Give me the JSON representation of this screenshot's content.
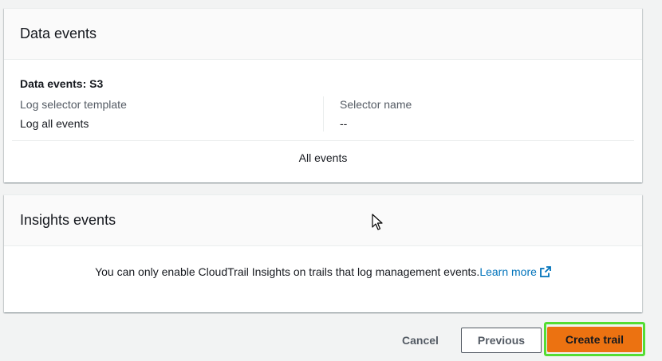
{
  "data_events_panel": {
    "header": "Data events",
    "section_title": "Data events: S3",
    "log_selector_label": "Log selector template",
    "log_selector_value": "Log all events",
    "selector_name_label": "Selector name",
    "selector_name_value": "--",
    "all_events_text": "All events"
  },
  "insights_panel": {
    "header": "Insights events",
    "message": "You can only enable CloudTrail Insights on trails that log management events.",
    "learn_more_label": "Learn more",
    "learn_more_icon": "external-link-icon"
  },
  "footer": {
    "cancel_label": "Cancel",
    "previous_label": "Previous",
    "create_label": "Create trail"
  },
  "colors": {
    "primary_button": "#ec7211",
    "highlight_outline": "#55dd33",
    "link": "#0073bb"
  }
}
